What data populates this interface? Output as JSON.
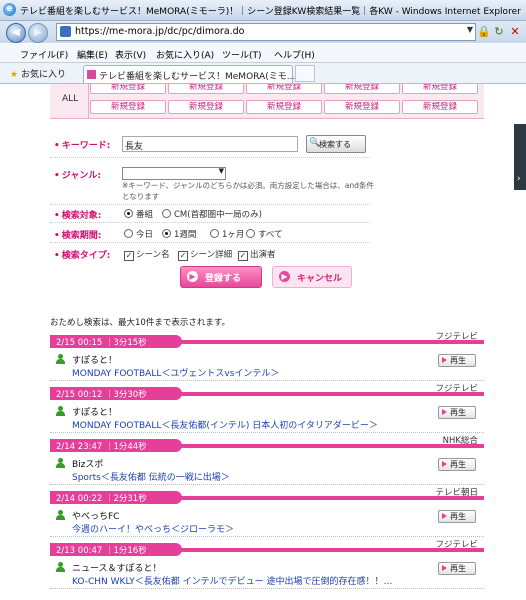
{
  "window": {
    "title": "テレビ番組を楽しむサービス！MeMORA(ミモーラ)！｜シーン登録KW検索結果一覧｜各KW - Windows Internet Explorer"
  },
  "address": {
    "url": "https://me-mora.jp/dc/pc/dimora.do"
  },
  "menu": [
    "ファイル(F)",
    "編集(E)",
    "表示(V)",
    "お気に入り(A)",
    "ツール(T)",
    "ヘルプ(H)"
  ],
  "favorites": {
    "label": "お気に入り",
    "tab_title": "テレビ番組を楽しむサービス！MeMORA(ミモ..."
  },
  "genre": {
    "all": "ALL",
    "row1": [
      "新規登録",
      "新規登録",
      "新規登録",
      "新規登録",
      "新規登録"
    ],
    "row2": [
      "新規登録",
      "新規登録",
      "新規登録",
      "新規登録",
      "新規登録"
    ]
  },
  "form": {
    "keyword_label": "キーワード:",
    "keyword_value": "長友",
    "search_button": "検索する",
    "genre_label": "ジャンル:",
    "genre_note": "※キーワード、ジャンルのどちらかは必須。両方設定した場合は、and条件となります",
    "target_label": "検索対象:",
    "target_opt1": "番組",
    "target_opt2": "CM(首都圏中一局のみ)",
    "period_label": "検索期間:",
    "period_opts": [
      "今日",
      "1週間",
      "1ヶ月",
      "すべて"
    ],
    "type_label": "検索タイプ:",
    "type_opts": [
      "シーン名",
      "シーン詳細",
      "出演者"
    ],
    "register_button": "登録する",
    "cancel_button": "キャンセル"
  },
  "intro": "おためし検索は、最大10件まで表示されます。",
  "results": [
    {
      "channel": "フジテレビ",
      "time": "2/15  00:15 ｜3分15秒",
      "program": "すぽると！",
      "title": "MONDAY FOOTBALL＜ユヴェントスvsインテル＞",
      "play": "再生"
    },
    {
      "channel": "フジテレビ",
      "time": "2/15  00:12 ｜3分30秒",
      "program": "すぽると！",
      "title": "MONDAY FOOTBALL＜長友佑都(インテル) 日本人初のイタリアダービー＞",
      "play": "再生"
    },
    {
      "channel": "NHK総合",
      "time": "2/14  23:47 ｜1分44秒",
      "program": "Bizスポ",
      "title": "Sports＜長友佑都 伝統の一戦に出場＞",
      "play": "再生"
    },
    {
      "channel": "テレビ朝日",
      "time": "2/14  00:22 ｜2分31秒",
      "program": "やべっちFC",
      "title": "今週のハーイ！やべっち＜ジローラモ＞",
      "play": "再生"
    },
    {
      "channel": "フジテレビ",
      "time": "2/13  00:47 ｜1分16秒",
      "program": "ニュース＆すぽると！",
      "title": "KO-CHN WKLY＜長友佑都 インテルでデビュー 途中出場で圧倒的存在感！！…",
      "play": "再生"
    }
  ],
  "colors": {
    "accent": "#e53f99",
    "link": "#1a3fb5"
  }
}
